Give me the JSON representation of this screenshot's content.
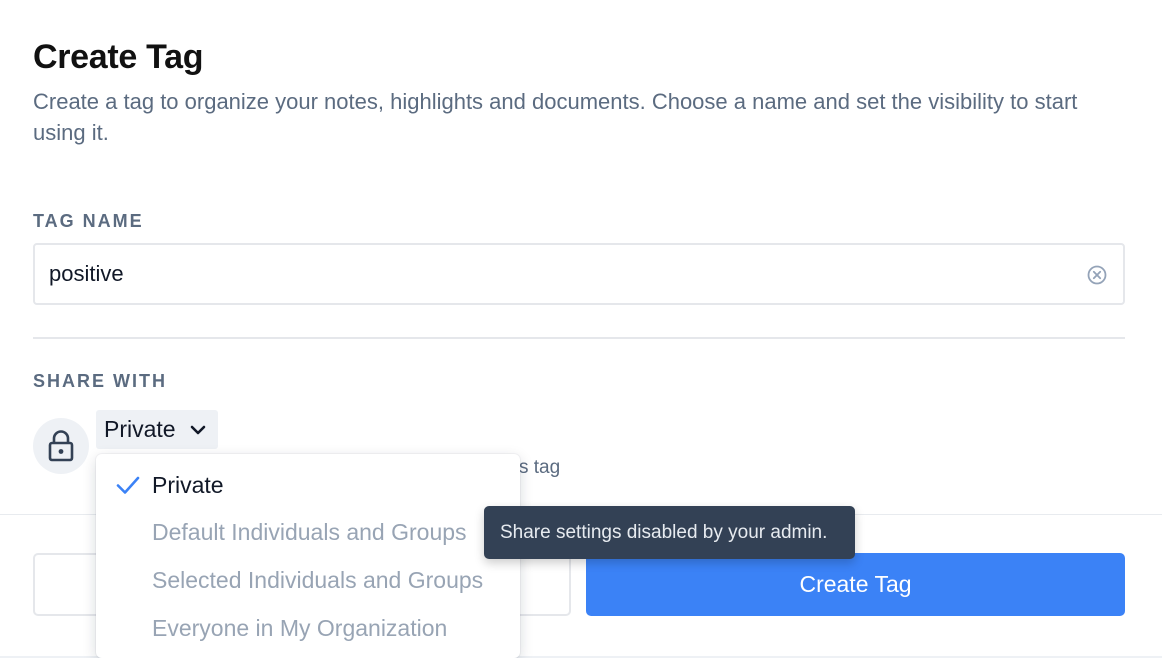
{
  "header": {
    "title": "Create Tag",
    "description": "Create a tag to organize your notes, highlights and documents. Choose a name and set the visibility to start using it."
  },
  "tag_name": {
    "label": "TAG NAME",
    "value": "positive",
    "clear_icon": "clear-circle-x-icon"
  },
  "share": {
    "label": "SHARE WITH",
    "lock_icon": "lock-icon",
    "selected": "Private",
    "chevron_icon": "chevron-down-icon",
    "helper_partial": "s tag"
  },
  "dropdown": {
    "options": [
      {
        "label": "Private",
        "selected": true,
        "disabled": false
      },
      {
        "label": "Default Individuals and Groups",
        "selected": false,
        "disabled": true
      },
      {
        "label": "Selected Individuals and Groups",
        "selected": false,
        "disabled": true
      },
      {
        "label": "Everyone in My Organization",
        "selected": false,
        "disabled": true
      }
    ],
    "check_icon": "check-icon",
    "accent": "#3b82f6"
  },
  "tooltip": {
    "text": "Share settings disabled by your admin."
  },
  "footer": {
    "create_label": "Create Tag",
    "primary_color": "#3b82f6"
  }
}
